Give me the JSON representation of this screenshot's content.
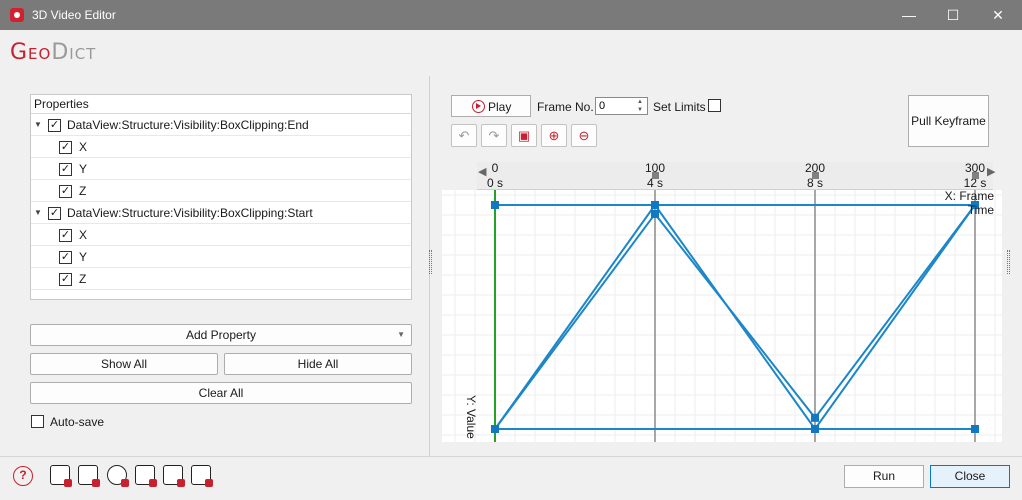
{
  "window": {
    "title": "3D Video Editor",
    "min_glyph": "—",
    "max_glyph": "☐",
    "close_glyph": "✕"
  },
  "logo": {
    "part1": "Geo",
    "part2": "Dict"
  },
  "properties": {
    "header": "Properties",
    "nodes": [
      {
        "label": "DataView:Structure:Visibility:BoxClipping:End",
        "checked": true,
        "children": [
          "X",
          "Y",
          "Z"
        ]
      },
      {
        "label": "DataView:Structure:Visibility:BoxClipping:Start",
        "checked": true,
        "children": [
          "X",
          "Y",
          "Z"
        ]
      }
    ],
    "check_glyph": "✓",
    "expand_glyph": "▼"
  },
  "buttons": {
    "add_property": "Add Property",
    "show_all": "Show All",
    "hide_all": "Hide All",
    "clear_all": "Clear All",
    "run": "Run",
    "close": "Close",
    "play": "Play",
    "pull_keyframe": "Pull Keyframe"
  },
  "autosave": {
    "label": "Auto-save",
    "checked": false
  },
  "frame": {
    "label": "Frame No.",
    "value": "0"
  },
  "set_limits": {
    "label": "Set Limits",
    "checked": false
  },
  "toolbar": {
    "undo": "↶",
    "redo": "↷",
    "zoom_in": "⊕",
    "zoom_out": "⊖",
    "fit": "▣"
  },
  "help": {
    "glyph": "?"
  },
  "chart_data": {
    "type": "line",
    "x_axis": {
      "label": "X: Frame\nTime",
      "ticks": [
        {
          "frame": 0,
          "time": "0 s"
        },
        {
          "frame": 100,
          "time": "4 s"
        },
        {
          "frame": 200,
          "time": "8 s"
        },
        {
          "frame": 300,
          "time": "12 s"
        }
      ],
      "range": [
        0,
        300
      ]
    },
    "y_axis": {
      "label": "Y: Value",
      "ticks": [
        0,
        100
      ],
      "range": [
        0,
        100
      ]
    },
    "keyframes": [
      0,
      100,
      200,
      300
    ],
    "grid": true,
    "current_frame": 0,
    "series": [
      {
        "x": [
          0,
          300
        ],
        "y": [
          100,
          100
        ]
      },
      {
        "x": [
          0,
          300
        ],
        "y": [
          0,
          0
        ]
      },
      {
        "x": [
          0,
          100,
          200,
          300
        ],
        "y": [
          0,
          100,
          0,
          100
        ]
      },
      {
        "x": [
          0,
          100,
          200,
          300
        ],
        "y": [
          0,
          96,
          5,
          100
        ]
      }
    ],
    "line_color": "#1c86c8",
    "marker_color": "#1178c2",
    "cursor_color": "#22a22a"
  }
}
